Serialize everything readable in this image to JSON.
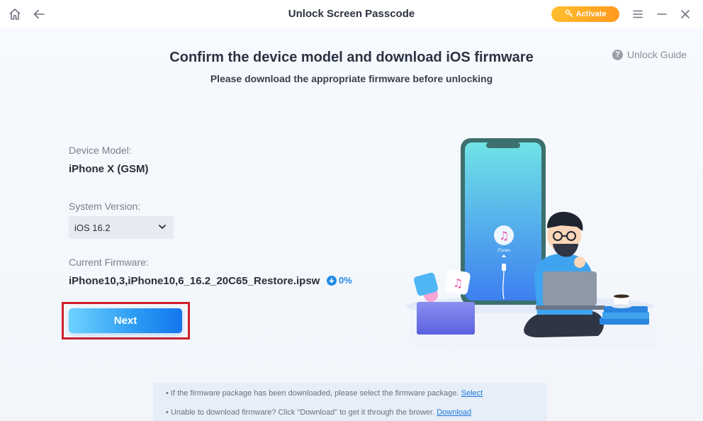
{
  "titlebar": {
    "title": "Unlock Screen Passcode",
    "activate_label": "Activate",
    "icons": [
      "home-icon",
      "back-arrow-icon",
      "key-icon",
      "menu-icon",
      "minimize-icon",
      "close-icon"
    ]
  },
  "main": {
    "heading": "Confirm the device model and download iOS firmware",
    "subheading": "Please download the appropriate firmware before unlocking",
    "guide_label": "Unlock Guide",
    "device_model_label": "Device Model:",
    "device_model_value": "iPhone X (GSM)",
    "system_version_label": "System Version:",
    "system_version_value": "iOS 16.2",
    "current_firmware_label": "Current Firmware:",
    "current_firmware_value": "iPhone10,3,iPhone10,6_16.2_20C65_Restore.ipsw",
    "download_progress": "0%",
    "next_label": "Next"
  },
  "illustration": {
    "phone_label": "iTunes"
  },
  "tips": {
    "tip1_text": "If the firmware package has been downloaded, please select the firmware package.",
    "tip1_link": "Select",
    "tip2_text": "Unable to download firmware? Click \"Download\" to get it through the brower.",
    "tip2_link": "Download"
  },
  "colors": {
    "accent": "#1f8be8",
    "activate": "#ffa726",
    "highlight": "#d0202b"
  }
}
